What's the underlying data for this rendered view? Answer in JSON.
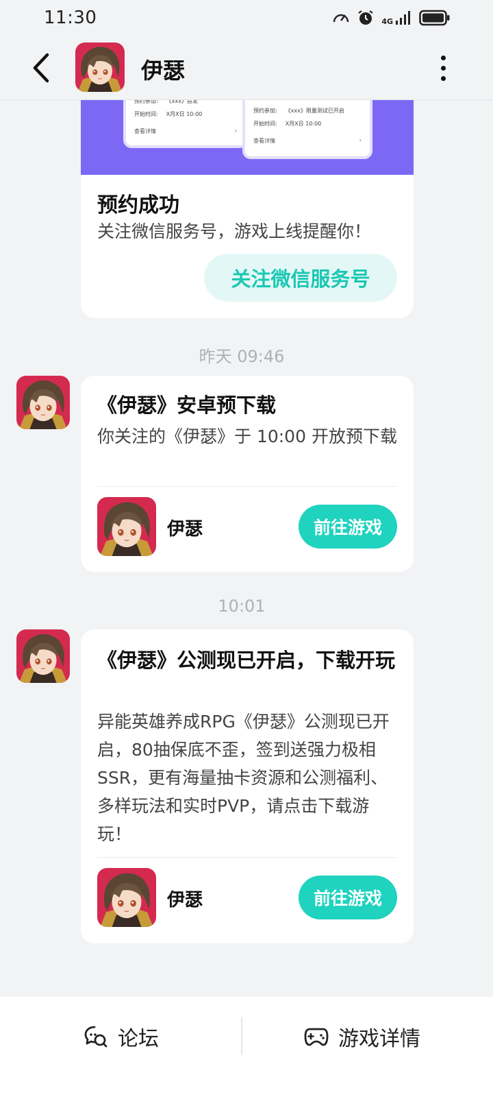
{
  "status_bar": {
    "time": "11:30",
    "network": "4G"
  },
  "header": {
    "title": "伊瑟"
  },
  "top_card": {
    "banner": {
      "left": {
        "row1_label": "预约参加:",
        "row1_value": "《xxx》首发",
        "row2_label": "开始时间:",
        "row2_value": "X月X日 10:00",
        "link": "查看详情"
      },
      "right": {
        "row1_label": "预约参加:",
        "row1_value": "《xxx》限量测试已开启",
        "row2_label": "开始时间:",
        "row2_value": "X月X日 10:00",
        "link": "查看详情"
      }
    },
    "title": "预约成功",
    "subtitle": "关注微信服务号，游戏上线提醒你！",
    "button": "关注微信服务号"
  },
  "messages": [
    {
      "timestamp": "昨天  09:46",
      "title": "《伊瑟》安卓预下载",
      "body": "你关注的《伊瑟》于 10:00 开放预下载",
      "game_name": "伊瑟",
      "button": "前往游戏"
    },
    {
      "timestamp": "10:01",
      "title": "《伊瑟》公测现已开启，下载开玩",
      "body": "异能英雄养成RPG《伊瑟》公测现已开启，80抽保底不歪，签到送强力极相SSR，更有海量抽卡资源和公测福利、多样玩法和实时PVP，请点击下载游玩！",
      "game_name": "伊瑟",
      "button": "前往游戏"
    }
  ],
  "bottom_bar": {
    "forum": "论坛",
    "game_detail": "游戏详情"
  },
  "colors": {
    "accent": "#1fd3bf",
    "accent_text": "#1bc7b3",
    "banner": "#7d68f5",
    "icon_red": "#d42a4f"
  }
}
